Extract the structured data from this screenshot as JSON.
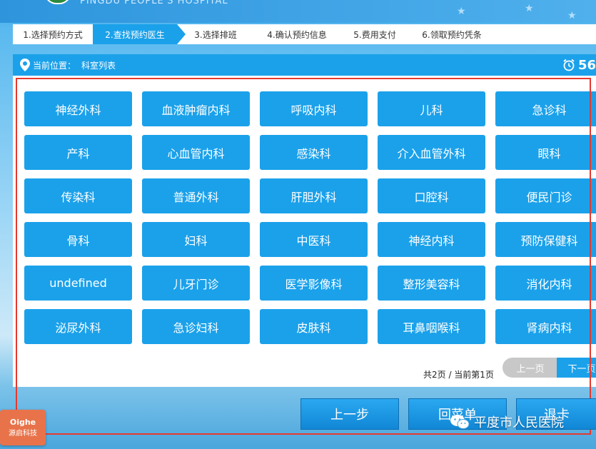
{
  "header": {
    "hospital_en": "PINGDU PEOPLE'S HOSPITAL"
  },
  "steps": [
    {
      "label": "1.选择预约方式",
      "active": false
    },
    {
      "label": "2.查找预约医生",
      "active": true
    },
    {
      "label": "3.选择排班",
      "active": false
    },
    {
      "label": "4.确认预约信息",
      "active": false
    },
    {
      "label": "5.费用支付",
      "active": false
    },
    {
      "label": "6.领取预约凭条",
      "active": false
    }
  ],
  "location": {
    "label": "当前位置：",
    "value": "科室列表",
    "icon": "location-pin-icon"
  },
  "timer": {
    "icon": "alarm-clock-icon",
    "value": "56"
  },
  "departments": [
    "神经外科",
    "血液肿瘤内科",
    "呼吸内科",
    "儿科",
    "急诊科",
    "产科",
    "心血管内科",
    "感染科",
    "介入血管外科",
    "眼科",
    "传染科",
    "普通外科",
    "肝胆外科",
    "口腔科",
    "便民门诊",
    "骨科",
    "妇科",
    "中医科",
    "神经内科",
    "预防保健科",
    "undefined",
    "儿牙门诊",
    "医学影像科",
    "整形美容科",
    "消化内科",
    "泌尿外科",
    "急诊妇科",
    "皮肤科",
    "耳鼻咽喉科",
    "肾病内科"
  ],
  "pagination": {
    "info": "共2页 / 当前第1页",
    "prev_label": "上一页",
    "next_label": "下一页"
  },
  "bottom": {
    "back_label": "上一步",
    "menu_label": "回菜单",
    "exit_label": "退卡"
  },
  "watermark": {
    "text": "平度市人民医院",
    "icon": "wechat-icon"
  },
  "badge": {
    "line1": "Oighe",
    "line2": "源启科技"
  },
  "colors": {
    "accent": "#1ba1ea",
    "frame": "#e5392f",
    "disabled": "#c8c8c8"
  }
}
